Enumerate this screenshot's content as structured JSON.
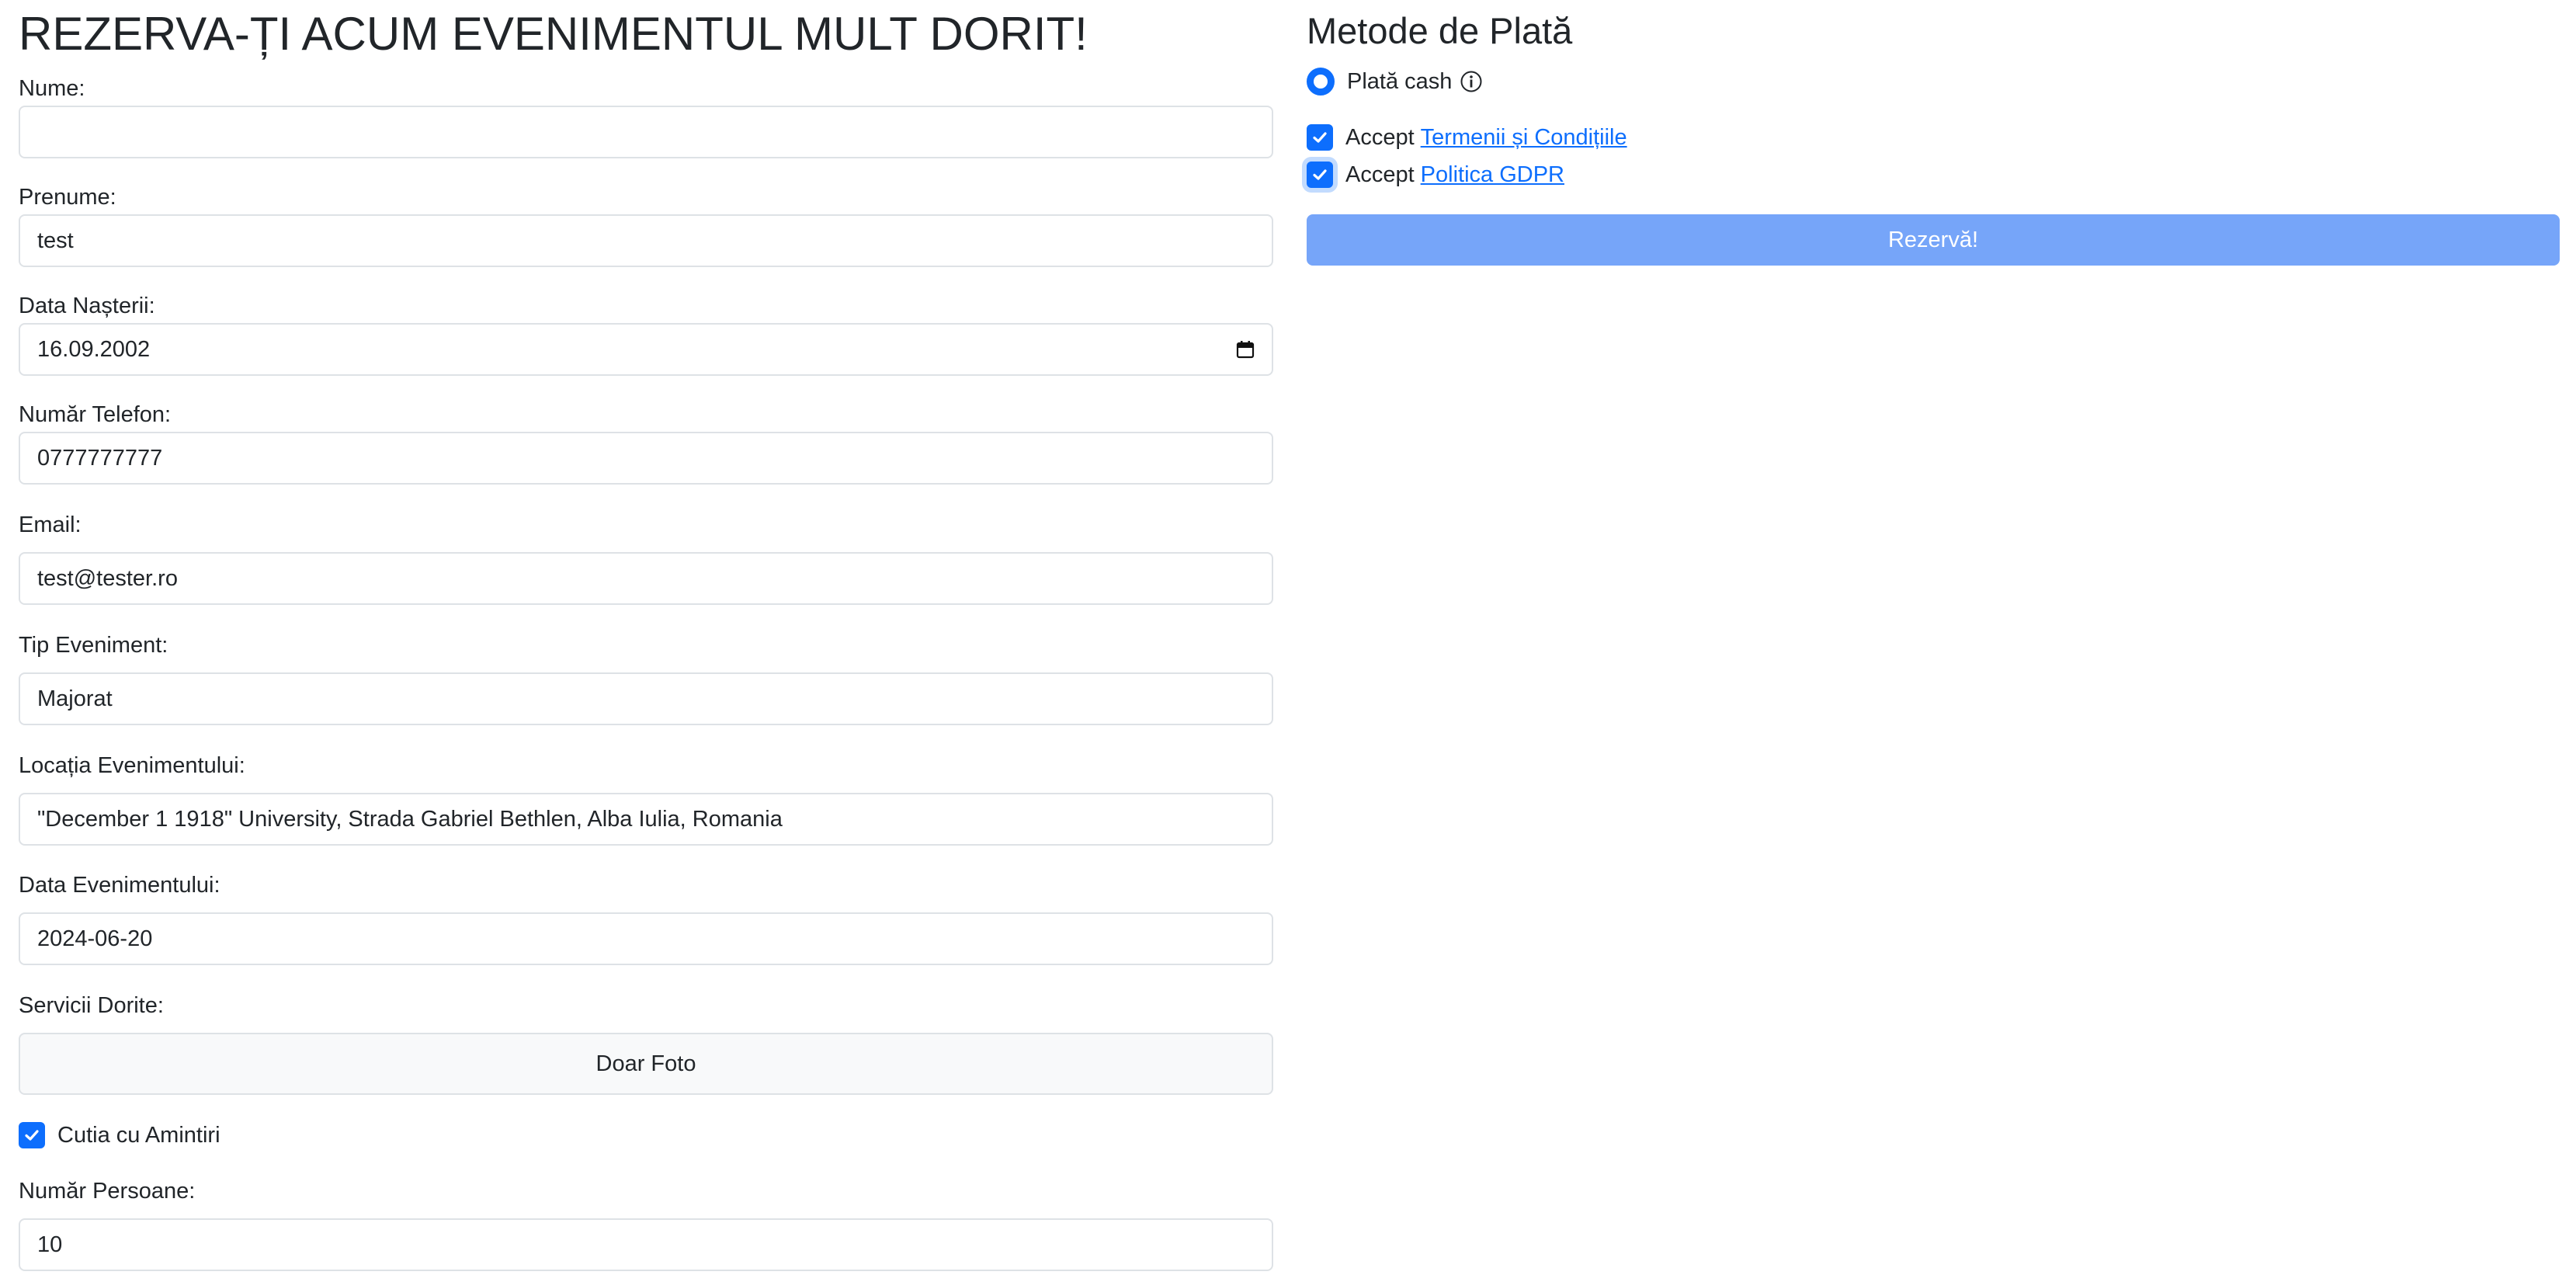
{
  "form": {
    "title": "REZERVA-ȚI ACUM EVENIMENTUL MULT DORIT!",
    "nume": {
      "label": "Nume:",
      "value": ""
    },
    "prenume": {
      "label": "Prenume:",
      "value": "test"
    },
    "data_nasterii": {
      "label": "Data Nașterii:",
      "value": "16.09.2002"
    },
    "telefon": {
      "label": "Număr Telefon:",
      "value": "0777777777"
    },
    "email": {
      "label": "Email:",
      "value": "test@tester.ro"
    },
    "tip_eveniment": {
      "label": "Tip Eveniment:",
      "value": "Majorat"
    },
    "locatia": {
      "label": "Locația Evenimentului:",
      "value": "\"December 1 1918\" University, Strada Gabriel Bethlen, Alba Iulia, Romania"
    },
    "data_evenimentului": {
      "label": "Data Evenimentului:",
      "value": "2024-06-20"
    },
    "servicii": {
      "label": "Servicii Dorite:",
      "button": "Doar Foto"
    },
    "cutia": {
      "label": "Cutia cu Amintiri",
      "checked": true
    },
    "persoane": {
      "label": "Număr Persoane:",
      "value": "10"
    }
  },
  "payment": {
    "title": "Metode de Plată",
    "cash": {
      "label": "Plată cash",
      "selected": true,
      "icon": "info-icon"
    },
    "terms": {
      "prefix": "Accept",
      "link": "Termenii și Condițiile",
      "checked": true
    },
    "gdpr": {
      "prefix": "Accept",
      "link": "Politica GDPR",
      "checked": true
    },
    "submit": "Rezervă!"
  },
  "colors": {
    "accent": "#0d6efd",
    "submit_disabled": "#76a5f9",
    "border": "#dee2e6",
    "text": "#212529"
  }
}
